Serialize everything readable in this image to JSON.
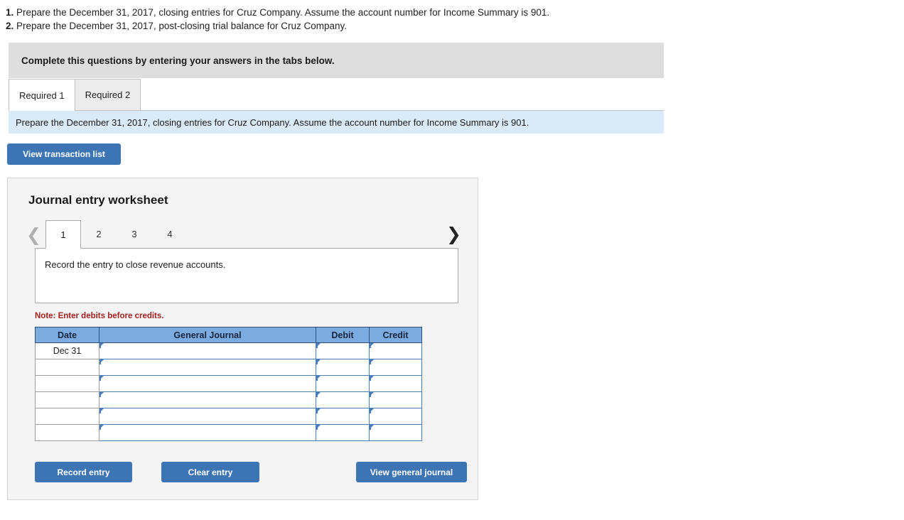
{
  "questions": [
    {
      "number": "1.",
      "text": "Prepare the December 31, 2017, closing entries for Cruz Company. Assume the account number for Income Summary is 901."
    },
    {
      "number": "2.",
      "text": "Prepare the December 31, 2017, post-closing trial balance for Cruz Company."
    }
  ],
  "instruction_banner": {
    "text": "Complete this questions by entering your answers in the tabs below."
  },
  "required_tabs": [
    {
      "label": "Required 1",
      "active": true
    },
    {
      "label": "Required 2",
      "active": false
    }
  ],
  "info_bar": {
    "text": "Prepare the December 31, 2017, closing entries for Cruz Company. Assume the account number for Income Summary is 901."
  },
  "view_transaction_list": {
    "label": "View transaction list"
  },
  "worksheet": {
    "title": "Journal entry worksheet",
    "pager": {
      "prev_icon": "chevron-left-icon",
      "next_icon": "chevron-right-icon",
      "pages": [
        "1",
        "2",
        "3",
        "4"
      ],
      "active_page": "1"
    },
    "description": "Record the entry to close revenue accounts.",
    "note": "Note: Enter debits before credits.",
    "table": {
      "headers": [
        "Date",
        "General Journal",
        "Debit",
        "Credit"
      ],
      "rows": [
        {
          "date": "Dec 31",
          "general_journal": "",
          "debit": "",
          "credit": ""
        },
        {
          "date": "",
          "general_journal": "",
          "debit": "",
          "credit": ""
        },
        {
          "date": "",
          "general_journal": "",
          "debit": "",
          "credit": ""
        },
        {
          "date": "",
          "general_journal": "",
          "debit": "",
          "credit": ""
        },
        {
          "date": "",
          "general_journal": "",
          "debit": "",
          "credit": ""
        },
        {
          "date": "",
          "general_journal": "",
          "debit": "",
          "credit": ""
        }
      ]
    },
    "actions": {
      "record_entry": "Record entry",
      "clear_entry": "Clear entry",
      "view_general_journal": "View general journal"
    }
  },
  "colors": {
    "accent_blue": "#3c74b4",
    "header_blue": "#7cabe0",
    "cell_border_blue": "#4a7ebb",
    "info_bar_blue": "#daeaf8",
    "banner_gray": "#dedede",
    "panel_gray": "#f4f4f4",
    "note_red": "#a32020"
  }
}
